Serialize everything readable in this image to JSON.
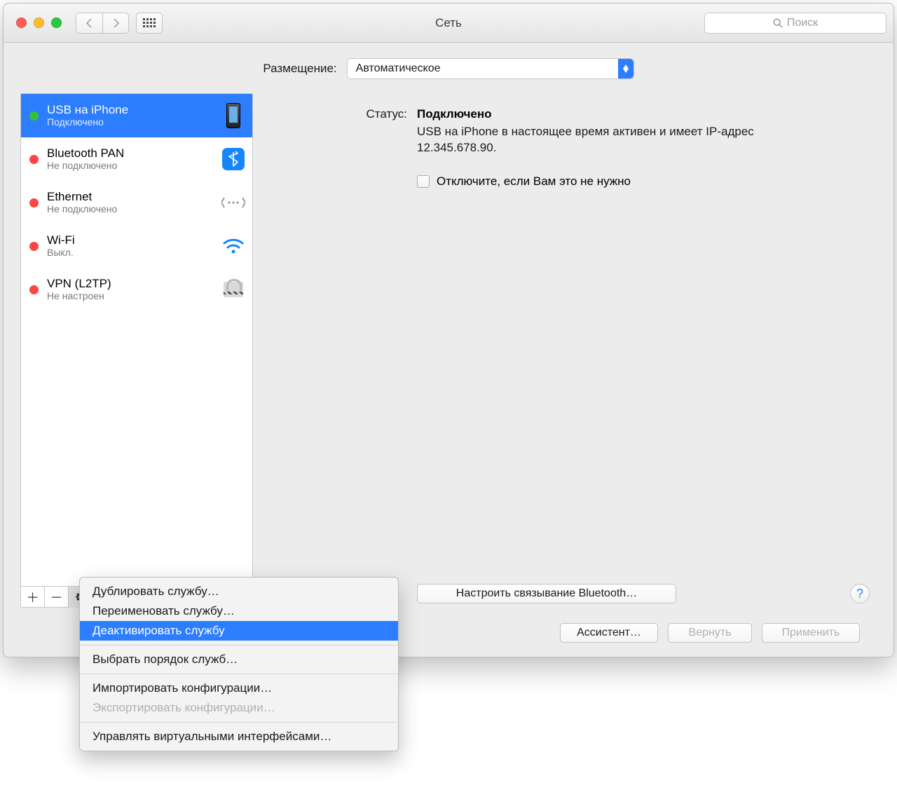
{
  "window": {
    "title": "Сеть"
  },
  "search": {
    "placeholder": "Поиск"
  },
  "location": {
    "label": "Размещение:",
    "value": "Автоматическое"
  },
  "services": [
    {
      "name": "USB на iPhone",
      "status": "Подключено",
      "dot": "green",
      "selected": true,
      "icon": "iphone"
    },
    {
      "name": "Bluetooth PAN",
      "status": "Не подключено",
      "dot": "red",
      "selected": false,
      "icon": "bluetooth"
    },
    {
      "name": "Ethernet",
      "status": "Не подключено",
      "dot": "red",
      "selected": false,
      "icon": "ethernet"
    },
    {
      "name": "Wi-Fi",
      "status": "Выкл.",
      "dot": "red",
      "selected": false,
      "icon": "wifi"
    },
    {
      "name": "VPN (L2TP)",
      "status": "Не настроен",
      "dot": "red",
      "selected": false,
      "icon": "lock"
    }
  ],
  "detail": {
    "status_label": "Статус:",
    "status_value": "Подключено",
    "description": "USB на iPhone в настоящее время активен и имеет IP-адрес 12.345.678.90.",
    "disable_label": "Отключите, если Вам это не нужно",
    "configure_button": "Настроить связывание Bluetooth…"
  },
  "footer": {
    "assistant": "Ассистент…",
    "revert": "Вернуть",
    "apply": "Применить"
  },
  "gear_menu": {
    "duplicate": "Дублировать службу…",
    "rename": "Переименовать службу…",
    "deactivate": "Деактивировать службу",
    "order": "Выбрать порядок служб…",
    "import": "Импортировать конфигурации…",
    "export": "Экспортировать конфигурации…",
    "manage_vifs": "Управлять виртуальными интерфейсами…"
  }
}
